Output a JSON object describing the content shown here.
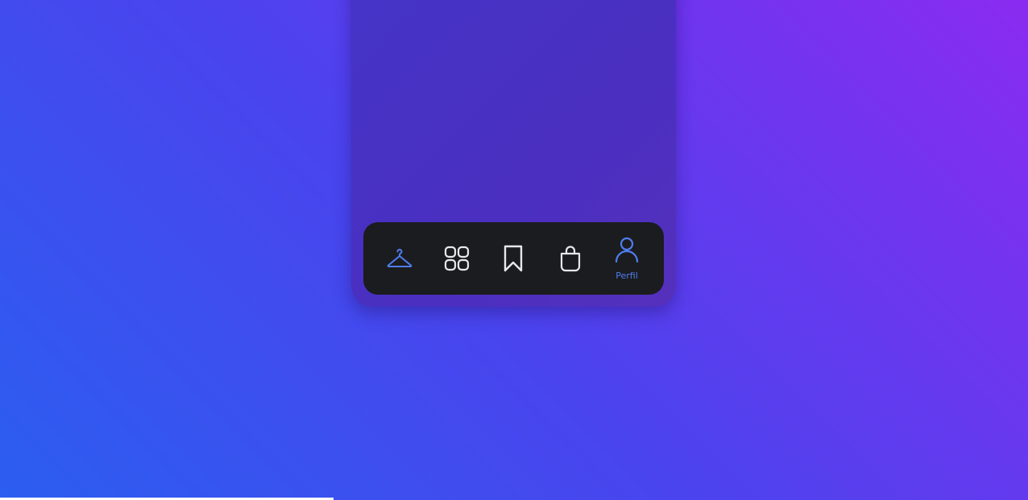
{
  "colors": {
    "active": "#4f7df0",
    "inactive": "#e8e8ea",
    "tabbar_background": "#1b1c1f"
  },
  "tabbar": {
    "items": [
      {
        "icon": "hanger-icon",
        "label": "",
        "active": true
      },
      {
        "icon": "grid-icon",
        "label": "",
        "active": false
      },
      {
        "icon": "bookmark-icon",
        "label": "",
        "active": false
      },
      {
        "icon": "shopping-bag-icon",
        "label": "",
        "active": false
      },
      {
        "icon": "user-icon",
        "label": "Perfil",
        "active": true
      }
    ]
  }
}
